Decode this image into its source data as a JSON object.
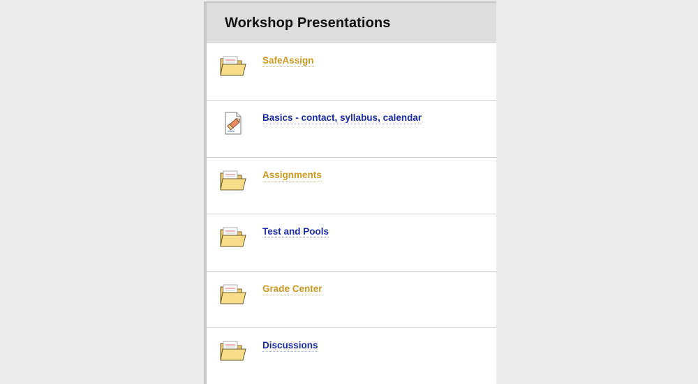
{
  "panel": {
    "title": "Workshop Presentations"
  },
  "items": [
    {
      "label": "SafeAssign",
      "icon": "folder-icon",
      "state": "visited",
      "color": "#cc9a22"
    },
    {
      "label": "Basics - contact, syllabus, calendar",
      "icon": "document-icon",
      "state": "unvisited",
      "color": "#1b2aa8"
    },
    {
      "label": "Assignments",
      "icon": "folder-icon",
      "state": "visited",
      "color": "#cc9a22"
    },
    {
      "label": "Test and Pools",
      "icon": "folder-icon",
      "state": "unvisited",
      "color": "#1b2aa8"
    },
    {
      "label": "Grade Center",
      "icon": "folder-icon",
      "state": "visited",
      "color": "#cc9a22"
    },
    {
      "label": "Discussions",
      "icon": "folder-icon",
      "state": "unvisited",
      "color": "#1b2aa8"
    }
  ]
}
